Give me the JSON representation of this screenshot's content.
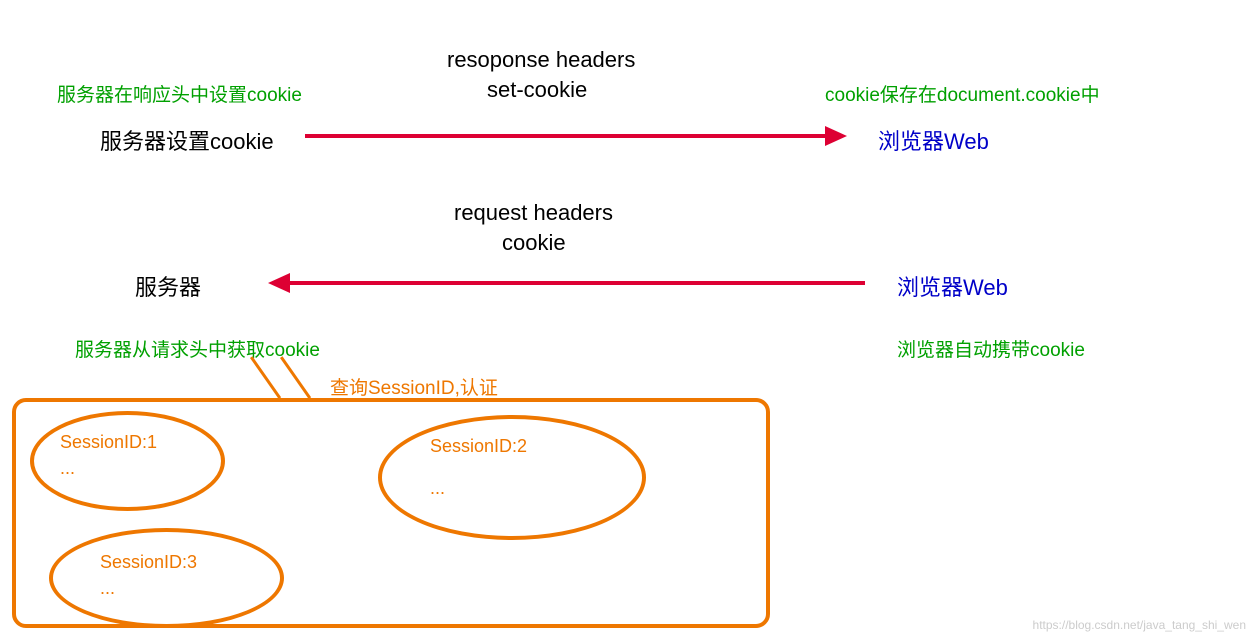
{
  "row1": {
    "greenLeft": "服务器在响应头中设置cookie",
    "headerTop": "resoponse headers",
    "headerBottom": "set-cookie",
    "greenRight": "cookie保存在document.cookie中",
    "blackLeft": "服务器设置cookie",
    "blueRight": "浏览器Web"
  },
  "row2": {
    "headerTop": "request headers",
    "headerBottom": "cookie",
    "blackLeft": "服务器",
    "blueRight": "浏览器Web",
    "greenLeft": "服务器从请求头中获取cookie",
    "greenRight": "浏览器自动携带cookie",
    "orangeNote": "查询SessionID,认证"
  },
  "sessions": {
    "s1": {
      "id": "SessionID:1",
      "dots": "..."
    },
    "s2": {
      "id": "SessionID:2",
      "dots": "..."
    },
    "s3": {
      "id": "SessionID:3",
      "dots": "..."
    }
  },
  "watermark": "https://blog.csdn.net/java_tang_shi_wen"
}
